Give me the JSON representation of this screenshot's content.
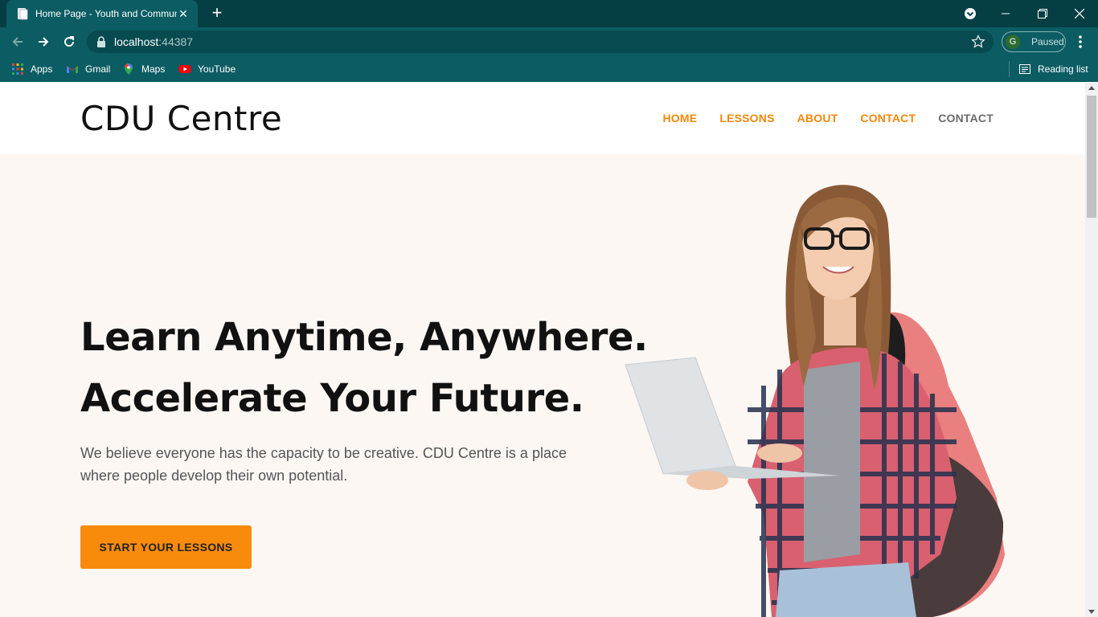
{
  "browser": {
    "tab_title": "Home Page - Youth and Community",
    "url_host": "localhost",
    "url_port": ":44387",
    "profile_initial": "G",
    "profile_status": "Paused",
    "bookmarks": [
      {
        "label": "Apps",
        "icon": "apps-grid-icon"
      },
      {
        "label": "Gmail",
        "icon": "gmail-icon"
      },
      {
        "label": "Maps",
        "icon": "maps-icon"
      },
      {
        "label": "YouTube",
        "icon": "youtube-icon"
      }
    ],
    "reading_list": "Reading list"
  },
  "site": {
    "brand": "CDU Centre",
    "nav": [
      {
        "label": "HOME",
        "state": "accent"
      },
      {
        "label": "LESSONS",
        "state": "accent"
      },
      {
        "label": "ABOUT",
        "state": "accent"
      },
      {
        "label": "CONTACT",
        "state": "accent"
      },
      {
        "label": "CONTACT",
        "state": "muted"
      }
    ]
  },
  "hero": {
    "headline_line1": "Learn Anytime, Anywhere.",
    "headline_line2": "Accelerate Your Future.",
    "subtext": "We believe everyone has the capacity to be creative. CDU Centre is a place where people develop their own potential.",
    "cta_label": "START YOUR LESSONS",
    "image_alt": "student-with-laptop-illustration"
  },
  "colors": {
    "chrome_dark": "#053f44",
    "chrome": "#0b5c63",
    "accent": "#f98b0c",
    "hero_bg": "#fdf7f3"
  }
}
